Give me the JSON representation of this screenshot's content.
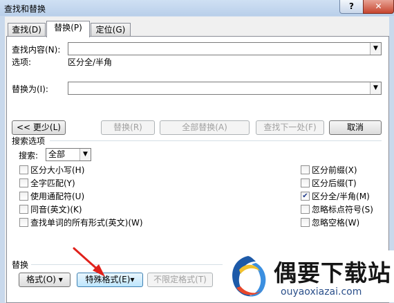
{
  "window": {
    "title": "查找和替换",
    "help": "?",
    "close": "✕"
  },
  "tabs": [
    {
      "label": "查找(D)"
    },
    {
      "label": "替换(P)"
    },
    {
      "label": "定位(G)"
    }
  ],
  "find": {
    "label": "查找内容(N):",
    "value": "",
    "options_label": "选项:",
    "options_value": "区分全/半角"
  },
  "replace": {
    "label": "替换为(I):",
    "value": ""
  },
  "buttons": {
    "less": "<< 更少(L)",
    "replace": "替换(R)",
    "replace_all": "全部替换(A)",
    "find_next": "查找下一处(F)",
    "cancel": "取消"
  },
  "search_options": {
    "title": "搜索选项",
    "search_label": "搜索:",
    "search_value": "全部",
    "left": [
      {
        "label": "区分大小写(H)",
        "checked": false
      },
      {
        "label": "全字匹配(Y)",
        "checked": false
      },
      {
        "label": "使用通配符(U)",
        "checked": false
      },
      {
        "label": "同音(英文)(K)",
        "checked": false
      },
      {
        "label": "查找单词的所有形式(英文)(W)",
        "checked": false
      }
    ],
    "right": [
      {
        "label": "区分前缀(X)",
        "checked": false
      },
      {
        "label": "区分后缀(T)",
        "checked": false
      },
      {
        "label": "区分全/半角(M)",
        "checked": true
      },
      {
        "label": "忽略标点符号(S)",
        "checked": false
      },
      {
        "label": "忽略空格(W)",
        "checked": false
      }
    ]
  },
  "replace_section": {
    "title": "替换",
    "format": "格式(O) ▾",
    "special": "特殊格式(E)▾",
    "no_format": "不限定格式(T)"
  },
  "watermark": {
    "text": "偶要下载站",
    "url": "ouyaoxiazai.com"
  },
  "colors": {
    "arrow_red": "#e0211b",
    "accent_blue": "#1d5aa8"
  }
}
